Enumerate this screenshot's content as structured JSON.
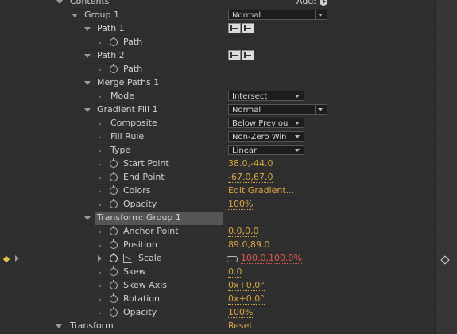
{
  "header": {
    "contents": "Contents",
    "add": "Add:"
  },
  "group1": {
    "label": "Group 1",
    "blend_mode": "Normal"
  },
  "path1": {
    "label": "Path 1",
    "path_label": "Path"
  },
  "path2": {
    "label": "Path 2",
    "path_label": "Path"
  },
  "merge": {
    "label": "Merge Paths 1",
    "mode_label": "Mode",
    "mode_value": "Intersect"
  },
  "gradient": {
    "label": "Gradient Fill 1",
    "blend_mode": "Normal",
    "composite_label": "Composite",
    "composite_value": "Below Previou",
    "fill_rule_label": "Fill Rule",
    "fill_rule_value": "Non-Zero Win",
    "type_label": "Type",
    "type_value": "Linear",
    "start_label": "Start Point",
    "start_value": "38.0,-44.0",
    "end_label": "End Point",
    "end_value": "-67.0,67.0",
    "colors_label": "Colors",
    "colors_value": "Edit Gradient...",
    "opacity_label": "Opacity",
    "opacity_value": "100%"
  },
  "transform_group": {
    "label": "Transform: Group 1",
    "anchor_label": "Anchor Point",
    "anchor_value": "0.0,0.0",
    "position_label": "Position",
    "position_value": "89.0,89.0",
    "scale_label": "Scale",
    "scale_value": "100.0,100.0%",
    "skew_label": "Skew",
    "skew_value": "0.0",
    "skew_axis_label": "Skew Axis",
    "skew_axis_value": "0x+0.0°",
    "rotation_label": "Rotation",
    "rotation_value": "0x+0.0°",
    "opacity_label": "Opacity",
    "opacity_value": "100%"
  },
  "layer_transform": {
    "label": "Transform",
    "reset": "Reset"
  },
  "colors": {
    "value_orange": "#d9a441",
    "value_red": "#e05a4a",
    "keyframe_yellow": "#e8c24a"
  }
}
